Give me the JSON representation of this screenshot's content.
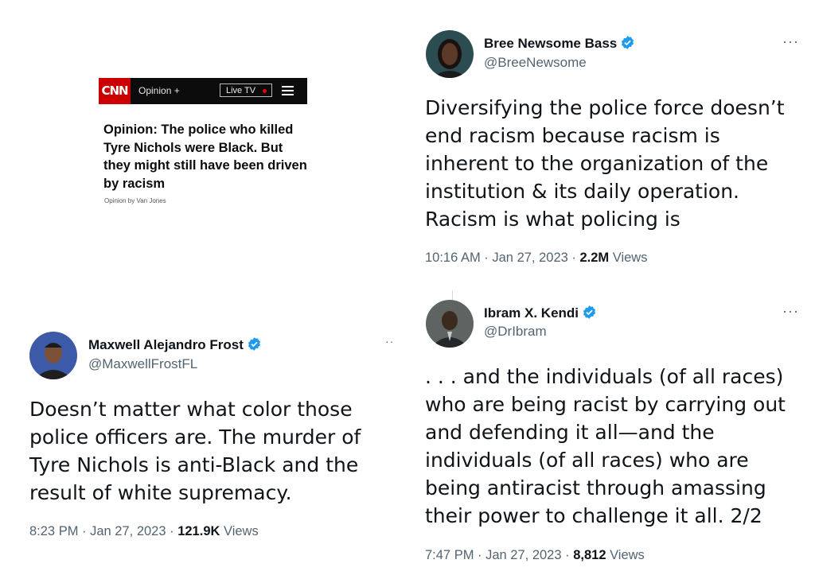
{
  "cnn": {
    "logo": "CNN",
    "section": "Opinion +",
    "live_label": "Live TV",
    "headline": "Opinion: The police who killed Tyre Nichols were Black. But they might still have been driven by racism",
    "byline": "Opinion by Van Jones"
  },
  "tweets": [
    {
      "name": "Bree Newsome Bass",
      "handle": "@BreeNewsome",
      "text": "Diversifying the police force doesn’t end racism because racism is inherent to the organization of the institution & its daily operation. Racism is what policing is",
      "time": "10:16 AM · Jan 27, 2023 · ",
      "views_count": "2.2M",
      "views_label": " Views",
      "more": "···"
    },
    {
      "name": "Ibram X. Kendi",
      "handle": "@DrIbram",
      "text": ". . . and the individuals (of all races) who are being racist by carrying out and defending it all—and the individuals (of all races) who are being antiracist through amassing their power to challenge it all. 2/2",
      "time": "7:47 PM · Jan 27, 2023 · ",
      "views_count": "8,812",
      "views_label": " Views",
      "more": "···"
    },
    {
      "name": "Maxwell Alejandro Frost",
      "handle": "@MaxwellFrostFL",
      "text": "Doesn’t matter what color those police officers are. The murder of Tyre Nichols is anti-Black and the result of white supremacy.",
      "time": "8:23 PM · Jan 27, 2023 · ",
      "views_count": "121.9K",
      "views_label": " Views",
      "more": "··"
    }
  ],
  "colors": {
    "verified": "#1d9bf0",
    "cnn_red": "#cc0000",
    "secondary_text": "#536471"
  },
  "icons": {
    "verified": "verified-badge-icon",
    "more": "more-options-icon",
    "menu": "hamburger-menu-icon"
  }
}
